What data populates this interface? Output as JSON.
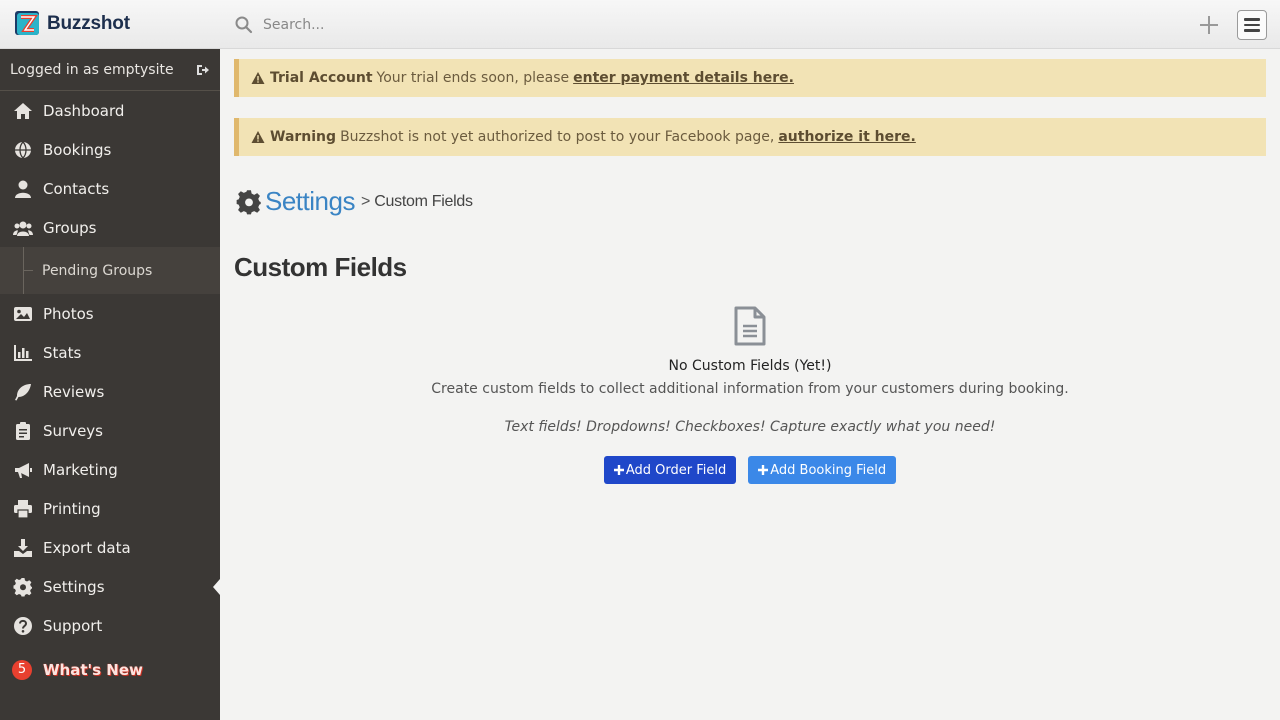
{
  "brand": {
    "name": "Buzzshot"
  },
  "search": {
    "placeholder": "Search..."
  },
  "sidebar": {
    "logged_in": "Logged in as emptysite",
    "items": [
      {
        "label": "Dashboard",
        "icon": "home-icon"
      },
      {
        "label": "Bookings",
        "icon": "globe-icon"
      },
      {
        "label": "Contacts",
        "icon": "user-icon"
      },
      {
        "label": "Groups",
        "icon": "users-icon"
      },
      {
        "label": "Pending Groups",
        "icon": ""
      },
      {
        "label": "Photos",
        "icon": "image-icon"
      },
      {
        "label": "Stats",
        "icon": "bar-chart-icon"
      },
      {
        "label": "Reviews",
        "icon": "feather-icon"
      },
      {
        "label": "Surveys",
        "icon": "clipboard-icon"
      },
      {
        "label": "Marketing",
        "icon": "bullhorn-icon"
      },
      {
        "label": "Printing",
        "icon": "printer-icon"
      },
      {
        "label": "Export data",
        "icon": "download-icon"
      },
      {
        "label": "Settings",
        "icon": "gear-icon"
      },
      {
        "label": "Support",
        "icon": "question-icon"
      },
      {
        "label": "What's New",
        "icon": ""
      }
    ],
    "whats_new_count": "5",
    "active": "Settings"
  },
  "alerts": [
    {
      "title": "Trial Account",
      "text": "Your trial ends soon, please",
      "link": "enter payment details here."
    },
    {
      "title": "Warning",
      "text": "Buzzshot is not yet authorized to post to your Facebook page,",
      "link": "authorize it here."
    }
  ],
  "breadcrumb": {
    "root": "Settings",
    "separator": ">",
    "current": "Custom Fields"
  },
  "page": {
    "title": "Custom Fields",
    "empty_title": "No Custom Fields (Yet!)",
    "empty_desc": "Create custom fields to collect additional information from your customers during booking.",
    "empty_note": "Text fields! Dropdowns! Checkboxes! Capture exactly what you need!",
    "add_order_label": "Add Order Field",
    "add_booking_label": "Add Booking Field"
  },
  "colors": {
    "sidebar": "#3b3835",
    "link": "#3a84c4",
    "order_button": "#1f47c9",
    "booking_button": "#3b88e8",
    "alert_bg": "#f2e3b5",
    "badge": "#e8402f"
  }
}
